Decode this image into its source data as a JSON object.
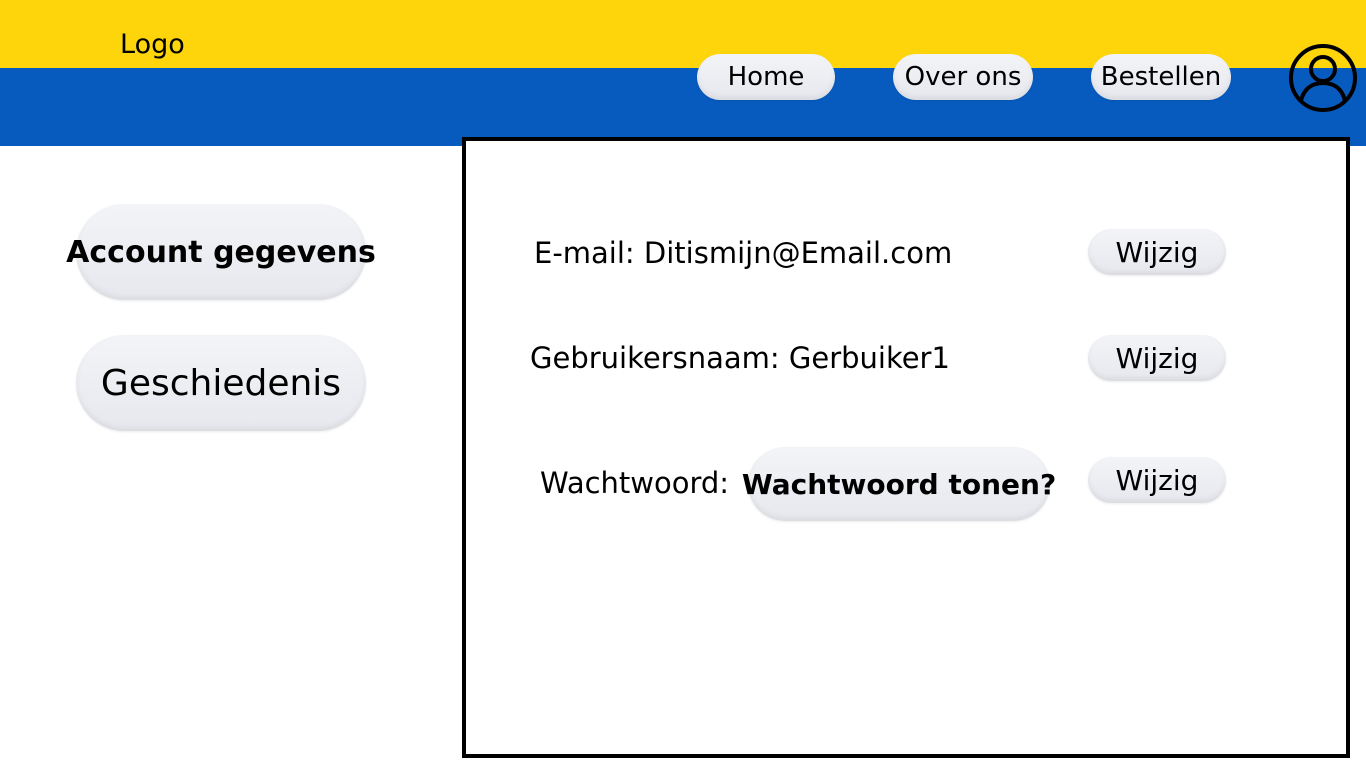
{
  "header": {
    "logo": "Logo",
    "nav": {
      "home": "Home",
      "about": "Over ons",
      "order": "Bestellen"
    },
    "avatar_icon": "user-profile-icon"
  },
  "sidebar": {
    "items": [
      {
        "label": "Account gegevens",
        "active": true
      },
      {
        "label": "Geschiedenis",
        "active": false
      }
    ]
  },
  "account": {
    "email": {
      "label": "E-mail: Ditismijn@Email.com",
      "action": "Wijzig"
    },
    "username": {
      "label": "Gebruikersnaam: Gerbuiker1",
      "action": "Wijzig"
    },
    "password": {
      "label": "Wachtwoord:",
      "show_label": "Wachtwoord tonen?",
      "action": "Wijzig"
    }
  },
  "colors": {
    "header_yellow": "#fdd50a",
    "header_blue": "#075bbf",
    "pill_bg": "#eceef2"
  }
}
